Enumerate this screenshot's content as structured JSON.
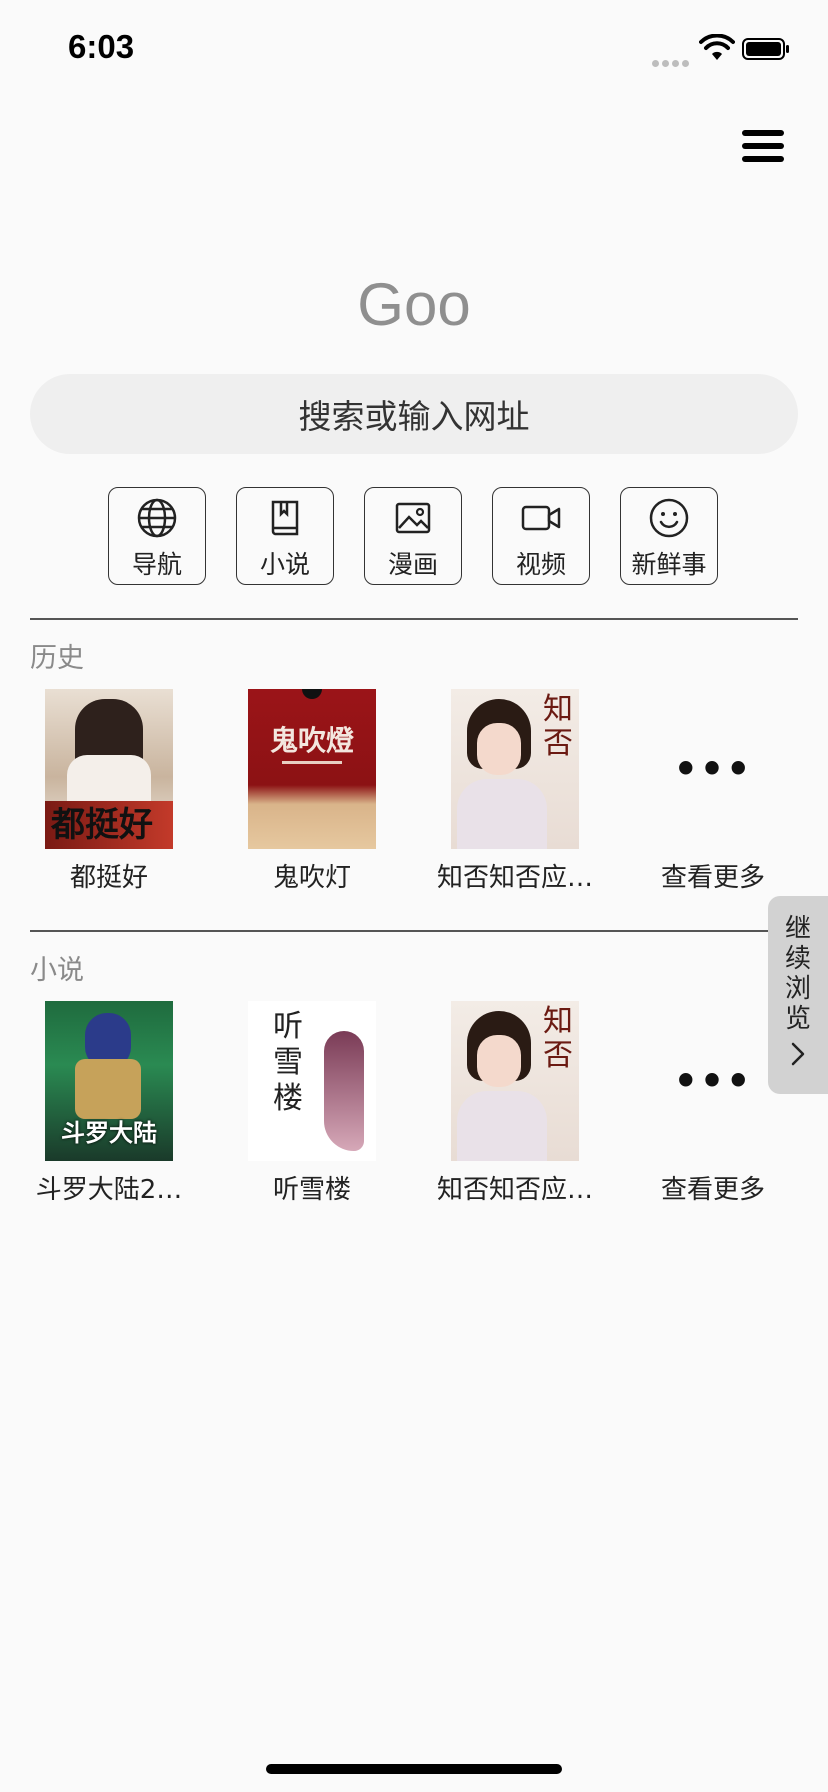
{
  "status_bar": {
    "time": "6:03"
  },
  "logo": "Goo",
  "search": {
    "placeholder": "搜索或输入网址"
  },
  "tools": [
    {
      "label": "导航",
      "icon": "globe-icon"
    },
    {
      "label": "小说",
      "icon": "book-icon"
    },
    {
      "label": "漫画",
      "icon": "image-icon"
    },
    {
      "label": "视频",
      "icon": "video-icon"
    },
    {
      "label": "新鲜事",
      "icon": "smile-icon"
    }
  ],
  "history": {
    "title": "历史",
    "items": [
      {
        "title": "都挺好",
        "cover_text": "都挺好"
      },
      {
        "title": "鬼吹灯",
        "cover_text": "鬼吹燈"
      },
      {
        "title": "知否知否应…",
        "cover_text": "知否"
      }
    ],
    "more_label": "查看更多"
  },
  "novels": {
    "title": "小说",
    "items": [
      {
        "title": "斗罗大陆2…",
        "cover_text": "斗罗大陆"
      },
      {
        "title": "听雪楼",
        "cover_text": "听雪楼"
      },
      {
        "title": "知否知否应…",
        "cover_text": "知否"
      }
    ],
    "more_label": "查看更多"
  },
  "side_tab": {
    "label": "继续浏览"
  },
  "colors": {
    "background": "#fafafa",
    "search_bg": "#efefef",
    "side_tab_bg": "#d2d2d2"
  }
}
